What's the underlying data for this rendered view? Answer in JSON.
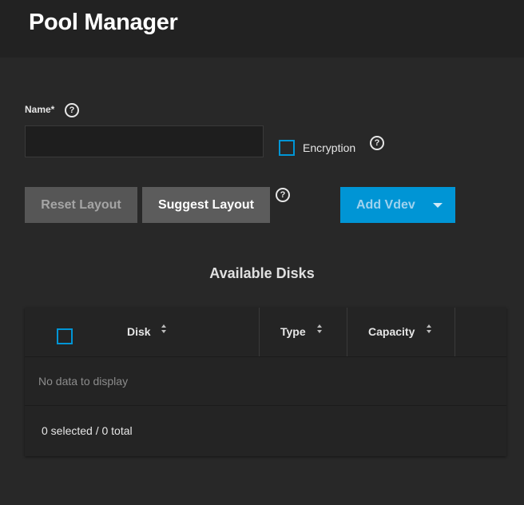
{
  "header": {
    "title": "Pool Manager"
  },
  "form": {
    "name_label": "Name*",
    "name_value": "",
    "encryption_label": "Encryption",
    "encryption_checked": false
  },
  "buttons": {
    "reset_layout": "Reset Layout",
    "suggest_layout": "Suggest Layout",
    "add_vdev": "Add Vdev"
  },
  "disks": {
    "title": "Available Disks",
    "columns": [
      "Disk",
      "Type",
      "Capacity"
    ],
    "rows": [],
    "empty_message": "No data to display",
    "footer": "0 selected / 0 total"
  },
  "colors": {
    "accent": "#0095d5",
    "background": "#282828",
    "header_bg": "#222222"
  },
  "icons": {
    "help": "question-circle-icon",
    "sort": "sort-arrows-icon",
    "dropdown": "caret-down-icon"
  }
}
